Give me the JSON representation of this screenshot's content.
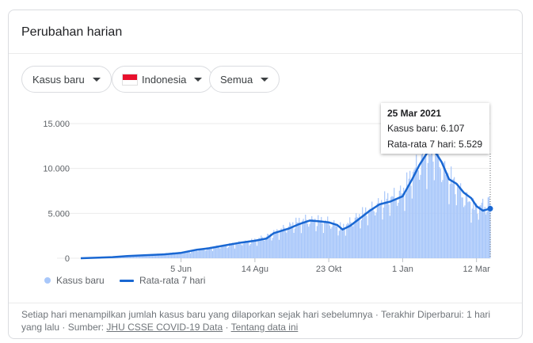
{
  "card": {
    "title": "Perubahan harian"
  },
  "filters": [
    {
      "label": "Kasus baru",
      "has_flag": false
    },
    {
      "label": "Indonesia",
      "has_flag": true,
      "flag_icon": "indonesia-flag-icon"
    },
    {
      "label": "Semua",
      "has_flag": false
    }
  ],
  "tooltip": {
    "date": "25 Mar 2021",
    "cases_label": "Kasus baru: 6.107",
    "avg_label": "Rata-rata 7 hari: 5.529"
  },
  "legend": {
    "bars_label": "Kasus baru",
    "line_label": "Rata-rata 7 hari"
  },
  "footer": {
    "text1": "Setiap hari menampilkan jumlah kasus baru yang dilaporkan sejak hari sebelumnya",
    "sep": " · ",
    "text2": "Terakhir Diperbarui: 1 hari yang lalu",
    "source_prefix": "Sumber: ",
    "source_link": "JHU CSSE COVID-19 Data",
    "about_link": "Tentang data ini"
  },
  "colors": {
    "bars": "#a8c7fa",
    "line": "#1967d2",
    "grid": "#ebebeb",
    "text": "#5f6368"
  },
  "chart_data": {
    "type": "bar",
    "title": "",
    "xlabel": "",
    "ylabel": "",
    "ylim": [
      0,
      15000
    ],
    "y_ticks": [
      {
        "value": 0,
        "label": "0"
      },
      {
        "value": 5000,
        "label": "5.000"
      },
      {
        "value": 10000,
        "label": "10.000"
      },
      {
        "value": 15000,
        "label": "15.000"
      }
    ],
    "x_ticks": [
      {
        "date": "2020-06-05",
        "label": "5 Jun"
      },
      {
        "date": "2020-08-14",
        "label": "14 Agu"
      },
      {
        "date": "2020-10-23",
        "label": "23 Okt"
      },
      {
        "date": "2021-01-01",
        "label": "1 Jan"
      },
      {
        "date": "2021-03-12",
        "label": "12 Mar"
      }
    ],
    "x_range": [
      "2020-03-02",
      "2021-03-25"
    ],
    "grid": true,
    "series": [
      {
        "name": "Kasus baru",
        "kind": "bar",
        "anchors": [
          [
            "2020-03-02",
            0
          ],
          [
            "2020-04-01",
            150
          ],
          [
            "2020-05-01",
            350
          ],
          [
            "2020-06-05",
            650
          ],
          [
            "2020-07-01",
            1100
          ],
          [
            "2020-08-01",
            1700
          ],
          [
            "2020-08-14",
            1950
          ],
          [
            "2020-09-01",
            2700
          ],
          [
            "2020-09-20",
            3800
          ],
          [
            "2020-10-01",
            4200
          ],
          [
            "2020-10-23",
            4000
          ],
          [
            "2020-11-05",
            3300
          ],
          [
            "2020-11-15",
            4200
          ],
          [
            "2020-12-01",
            5300
          ],
          [
            "2020-12-15",
            6300
          ],
          [
            "2021-01-01",
            7200
          ],
          [
            "2021-01-15",
            10200
          ],
          [
            "2021-01-30",
            12000
          ],
          [
            "2021-02-10",
            9500
          ],
          [
            "2021-02-25",
            7300
          ],
          [
            "2021-03-10",
            5500
          ],
          [
            "2021-03-25",
            6107
          ]
        ]
      },
      {
        "name": "Rata-rata 7 hari",
        "kind": "line",
        "points": [
          [
            "2020-03-02",
            0
          ],
          [
            "2020-04-01",
            120
          ],
          [
            "2020-04-15",
            250
          ],
          [
            "2020-05-01",
            330
          ],
          [
            "2020-05-20",
            430
          ],
          [
            "2020-06-05",
            600
          ],
          [
            "2020-06-20",
            950
          ],
          [
            "2020-07-01",
            1100
          ],
          [
            "2020-07-15",
            1400
          ],
          [
            "2020-08-01",
            1750
          ],
          [
            "2020-08-14",
            1950
          ],
          [
            "2020-08-25",
            2200
          ],
          [
            "2020-09-01",
            2800
          ],
          [
            "2020-09-15",
            3300
          ],
          [
            "2020-09-25",
            3800
          ],
          [
            "2020-10-05",
            4200
          ],
          [
            "2020-10-15",
            4100
          ],
          [
            "2020-10-23",
            4000
          ],
          [
            "2020-10-31",
            3700
          ],
          [
            "2020-11-05",
            3200
          ],
          [
            "2020-11-12",
            3600
          ],
          [
            "2020-11-20",
            4300
          ],
          [
            "2020-12-01",
            5300
          ],
          [
            "2020-12-10",
            6000
          ],
          [
            "2020-12-20",
            6300
          ],
          [
            "2021-01-01",
            6900
          ],
          [
            "2021-01-10",
            8800
          ],
          [
            "2021-01-17",
            10400
          ],
          [
            "2021-01-24",
            11700
          ],
          [
            "2021-01-31",
            12000
          ],
          [
            "2021-02-07",
            10700
          ],
          [
            "2021-02-14",
            8800
          ],
          [
            "2021-02-21",
            8300
          ],
          [
            "2021-02-28",
            7300
          ],
          [
            "2021-03-07",
            6700
          ],
          [
            "2021-03-12",
            5800
          ],
          [
            "2021-03-18",
            5300
          ],
          [
            "2021-03-25",
            5529
          ]
        ]
      }
    ],
    "highlight": {
      "date": "2021-03-25",
      "cases": 6107,
      "avg": 5529
    },
    "legend_position": "bottom-left"
  }
}
